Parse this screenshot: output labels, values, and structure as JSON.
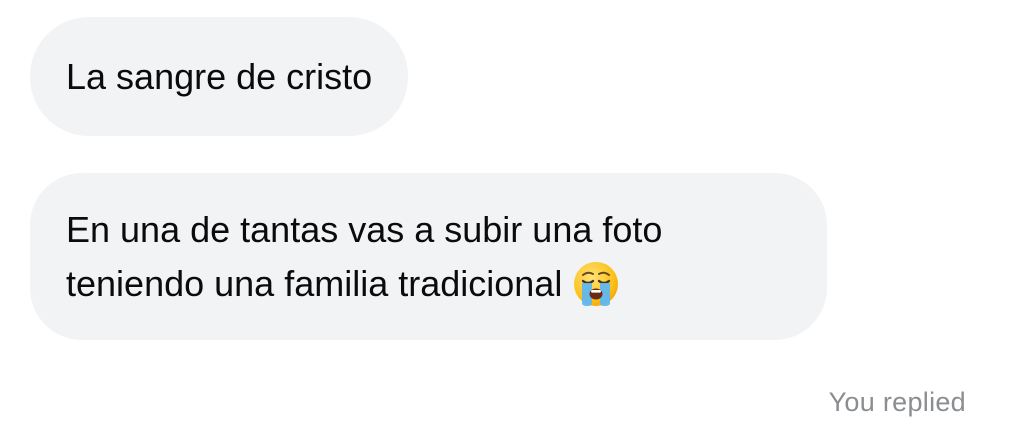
{
  "messages": [
    {
      "lines": [
        "La sangre de cristo"
      ]
    },
    {
      "lines": [
        "En una de tantas vas a subir una foto",
        "teniendo una familia tradicional"
      ],
      "trailing_emoji": "loudly-crying-face-icon"
    }
  ],
  "status": "You replied",
  "colors": {
    "bubble_background": "#f2f3f5",
    "message_text": "#0b0b0b",
    "status_text": "#8a8d91"
  }
}
